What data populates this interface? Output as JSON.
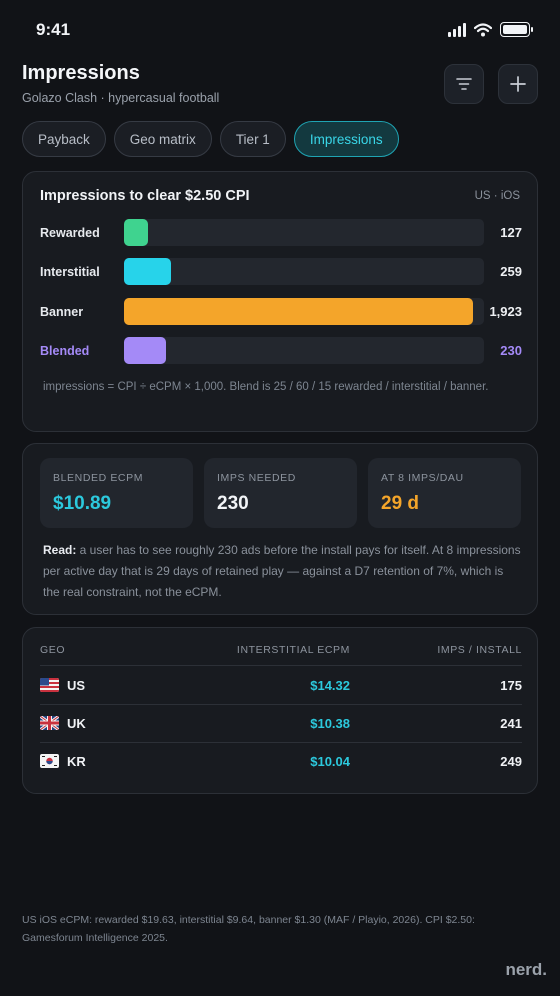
{
  "status_bar": {
    "time": "9:41"
  },
  "header": {
    "title": "Impressions",
    "subtitle": "Golazo Clash · hypercasual football",
    "filter_icon": "filter-icon",
    "add_icon": "plus-icon"
  },
  "tabs": [
    {
      "label": "Payback",
      "active": false
    },
    {
      "label": "Geo matrix",
      "active": false
    },
    {
      "label": "Tier 1",
      "active": false
    },
    {
      "label": "Impressions",
      "active": true
    }
  ],
  "impressions_card": {
    "title": "Impressions to clear $2.50 CPI",
    "tag": "US · iOS",
    "max": 1923,
    "bars": [
      {
        "label": "Rewarded",
        "value": 127,
        "value_label": "127",
        "color": "#3fd38f"
      },
      {
        "label": "Interstitial",
        "value": 259,
        "value_label": "259",
        "color": "#27d3ea"
      },
      {
        "label": "Banner",
        "value": 1923,
        "value_label": "1,923",
        "color": "#f4a52a"
      },
      {
        "label": "Blended",
        "value": 230,
        "value_label": "230",
        "color": "#a48af7"
      }
    ],
    "note": "impressions = CPI ÷ eCPM × 1,000. Blend is 25 / 60 / 15 rewarded / interstitial / banner."
  },
  "summary_card": {
    "stats": [
      {
        "label": "BLENDED ECPM",
        "value": "$10.89",
        "color": "#2cc9dd"
      },
      {
        "label": "IMPS NEEDED",
        "value": "230",
        "color": "#f2f4f7"
      },
      {
        "label": "AT 8 IMPS/DAU",
        "value": "29 d",
        "color": "#f4a52a"
      }
    ],
    "read_label": "Read:",
    "read_text": " a user has to see roughly 230 ads before the install pays for itself. At 8 impressions per active day that is 29 days of retained play — against a D7 retention of 7%, which is the real constraint, not the eCPM."
  },
  "geo_table": {
    "headers": {
      "geo": "GEO",
      "ecpm": "INTERSTITIAL ECPM",
      "imps": "IMPS / INSTALL"
    },
    "rows": [
      {
        "flag": "us-flag-icon",
        "geo": "US",
        "ecpm": "$14.32",
        "imps": "175"
      },
      {
        "flag": "uk-flag-icon",
        "geo": "UK",
        "ecpm": "$10.38",
        "imps": "241"
      },
      {
        "flag": "kr-flag-icon",
        "geo": "KR",
        "ecpm": "$10.04",
        "imps": "249"
      }
    ]
  },
  "footnote": "US iOS eCPM: rewarded $19.63, interstitial $9.64, banner $1.30 (MAF / Playio, 2026). CPI $2.50: Gamesforum Intelligence 2025.",
  "brand": "nerd."
}
